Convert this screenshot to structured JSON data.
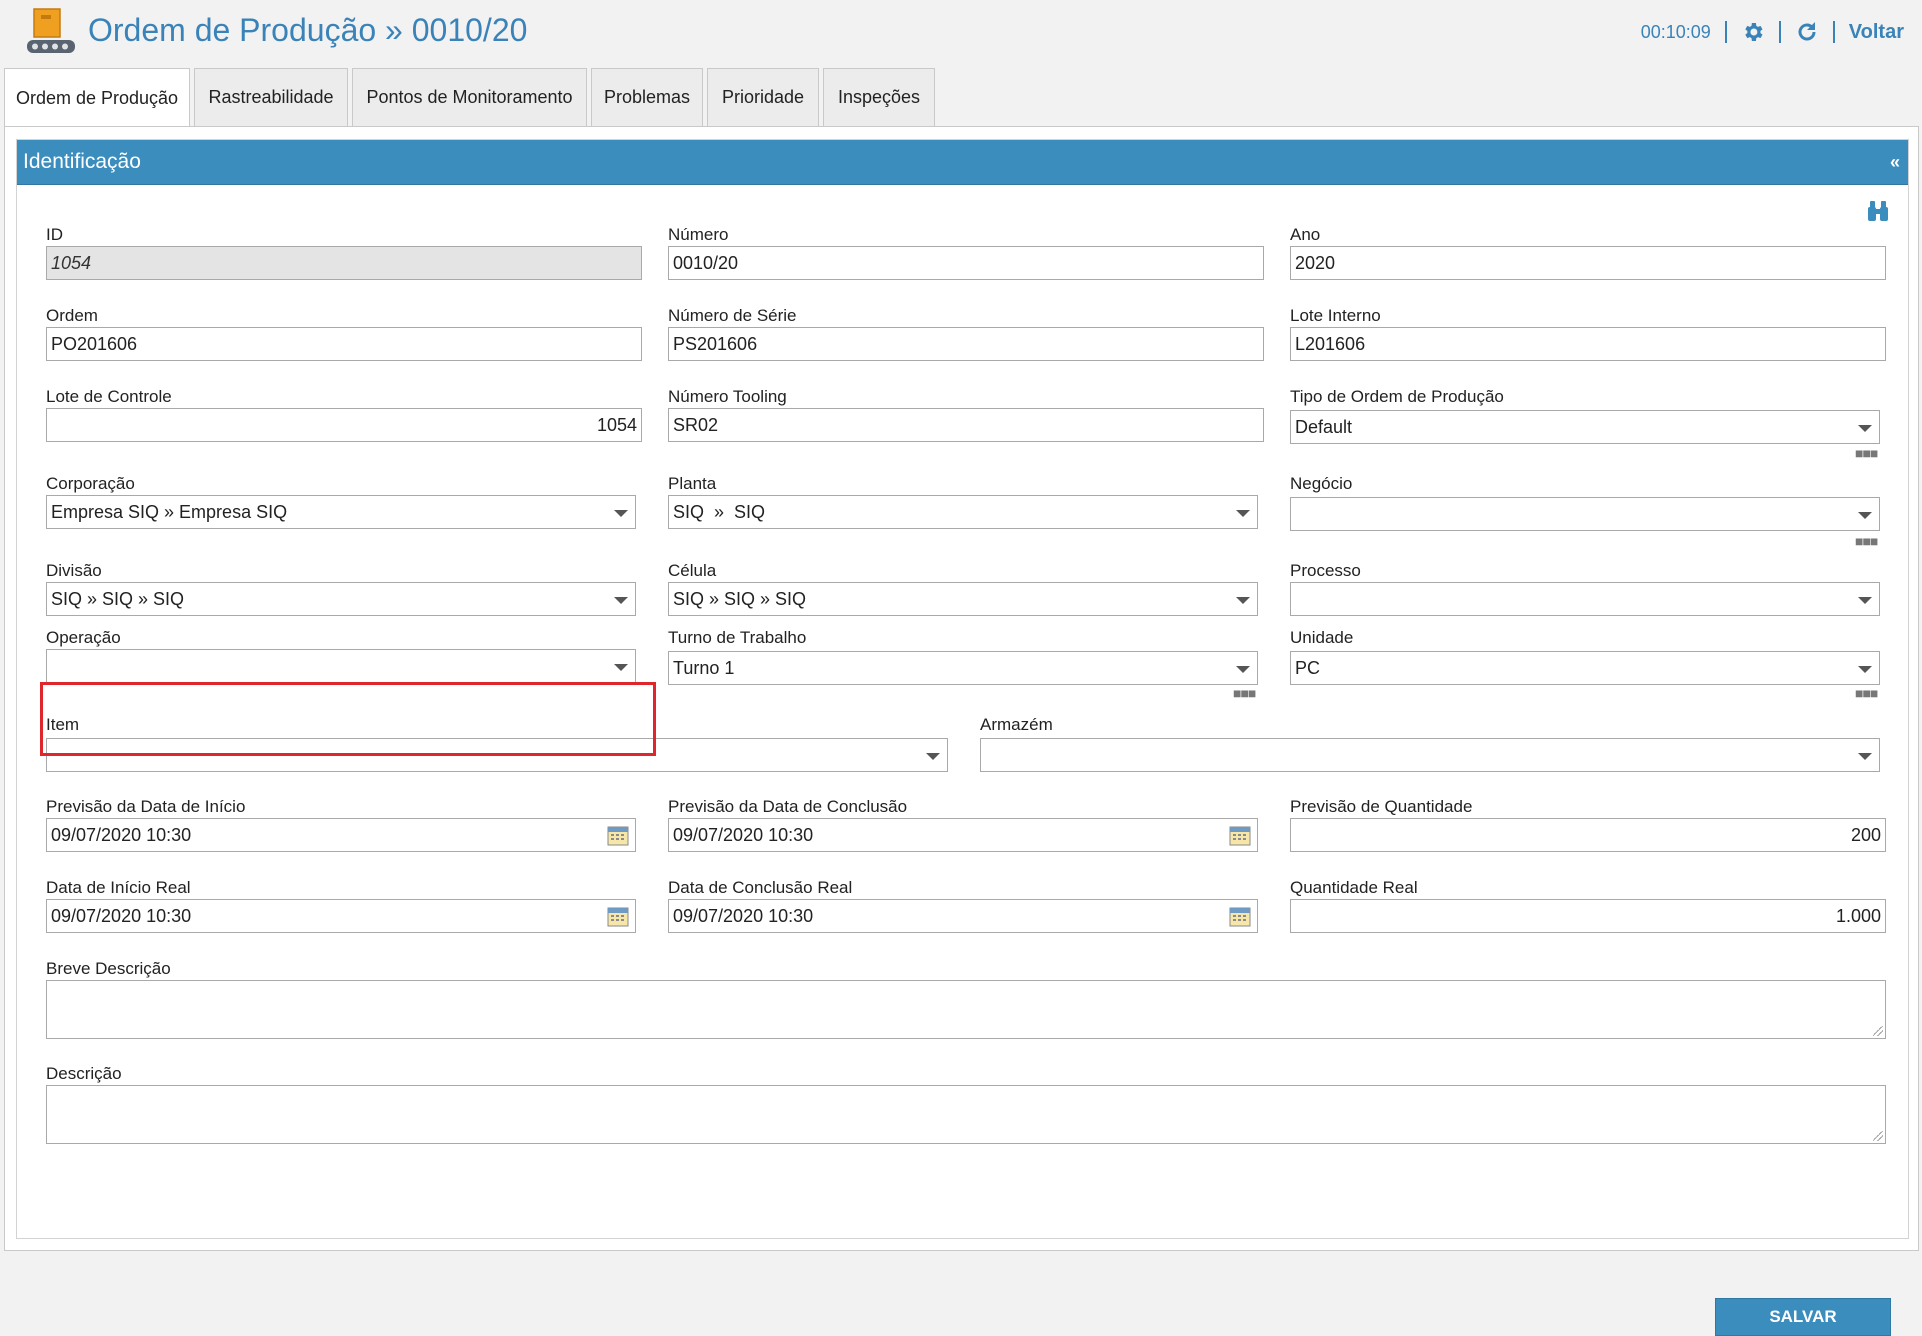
{
  "header": {
    "title": "Ordem de Produção » 0010/20",
    "timer": "00:10:09",
    "back_label": "Voltar",
    "accent_color": "#3a83b8"
  },
  "tabs": [
    {
      "label": "Ordem de Produção",
      "active": true
    },
    {
      "label": "Rastreabilidade"
    },
    {
      "label": "Pontos de Monitoramento"
    },
    {
      "label": "Problemas"
    },
    {
      "label": "Prioridade"
    },
    {
      "label": "Inspeções"
    }
  ],
  "section": {
    "title": "Identificação",
    "collapse_label": "«"
  },
  "fields": {
    "id": {
      "label": "ID",
      "value": "1054"
    },
    "numero": {
      "label": "Número",
      "value": "0010/20"
    },
    "ano": {
      "label": "Ano",
      "value": "2020"
    },
    "ordem": {
      "label": "Ordem",
      "value": "PO201606"
    },
    "numero_serie": {
      "label": "Número de Série",
      "value": "PS201606"
    },
    "lote_interno": {
      "label": "Lote Interno",
      "value": "L201606"
    },
    "lote_controle": {
      "label": "Lote de Controle",
      "value": "1054"
    },
    "numero_tooling": {
      "label": "Número Tooling",
      "value": "SR02"
    },
    "tipo_ordem": {
      "label": "Tipo de Ordem de Produção",
      "value": "Default"
    },
    "corporacao": {
      "label": "Corporação",
      "value": "Empresa SIQ » Empresa SIQ"
    },
    "planta": {
      "label": "Planta",
      "value": "SIQ  »  SIQ"
    },
    "negocio": {
      "label": "Negócio",
      "value": ""
    },
    "divisao": {
      "label": "Divisão",
      "value": "SIQ » SIQ » SIQ"
    },
    "celula": {
      "label": "Célula",
      "value": "SIQ » SIQ » SIQ"
    },
    "processo": {
      "label": "Processo",
      "value": ""
    },
    "operacao": {
      "label": "Operação",
      "value": ""
    },
    "turno": {
      "label": "Turno de Trabalho",
      "value": "Turno 1"
    },
    "unidade": {
      "label": "Unidade",
      "value": "PC"
    },
    "item": {
      "label": "Item",
      "value": ""
    },
    "armazem": {
      "label": "Armazém",
      "value": ""
    },
    "prev_inicio": {
      "label": "Previsão da Data de Início",
      "value": "09/07/2020 10:30"
    },
    "prev_conclusao": {
      "label": "Previsão da Data de Conclusão",
      "value": "09/07/2020 10:30"
    },
    "prev_quantidade": {
      "label": "Previsão de Quantidade",
      "value": "200"
    },
    "inicio_real": {
      "label": "Data de Início Real",
      "value": "09/07/2020 10:30"
    },
    "conclusao_real": {
      "label": "Data de Conclusão Real",
      "value": "09/07/2020 10:30"
    },
    "quantidade_real": {
      "label": "Quantidade Real",
      "value": "1.000"
    },
    "breve_descricao": {
      "label": "Breve Descrição",
      "value": ""
    },
    "descricao": {
      "label": "Descrição",
      "value": ""
    }
  },
  "actions": {
    "save_label": "SALVAR"
  }
}
